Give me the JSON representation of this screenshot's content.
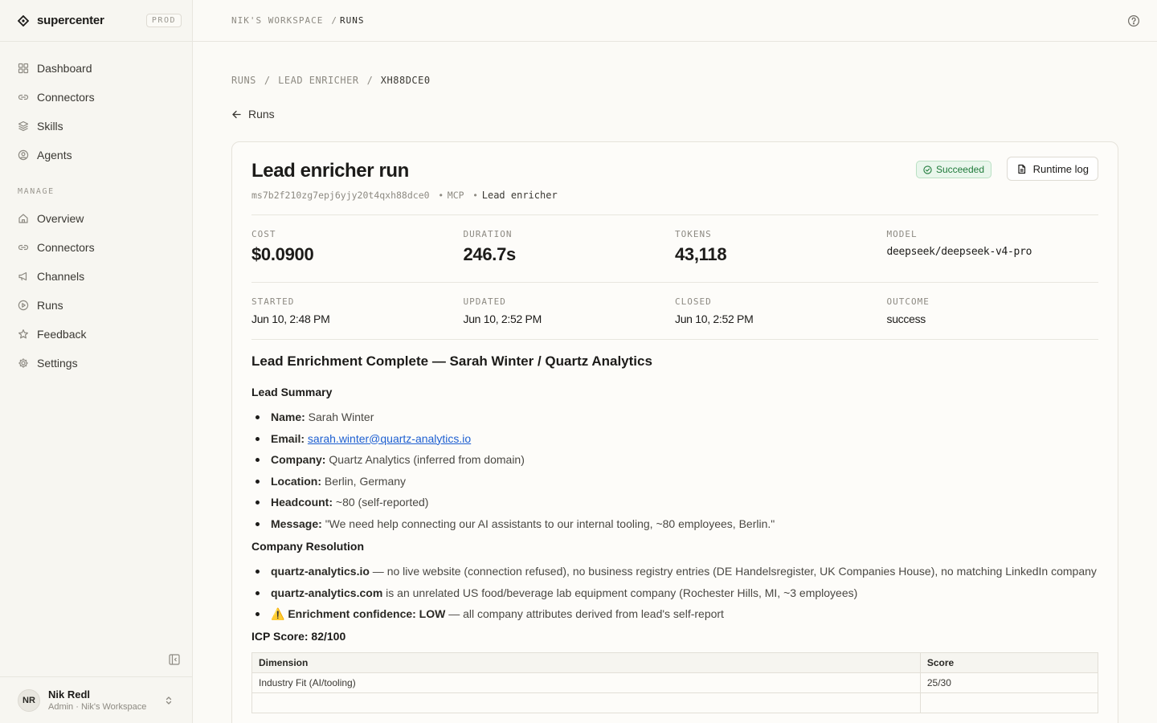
{
  "sidebar": {
    "brand": "supercenter",
    "env": "PROD",
    "items": [
      {
        "label": "Dashboard",
        "icon": "grid-icon"
      },
      {
        "label": "Connectors",
        "icon": "link-icon"
      },
      {
        "label": "Skills",
        "icon": "layers-icon"
      },
      {
        "label": "Agents",
        "icon": "user-circle-icon"
      }
    ],
    "manage_label": "MANAGE",
    "manage_items": [
      {
        "label": "Overview",
        "icon": "home-icon"
      },
      {
        "label": "Connectors",
        "icon": "link-icon"
      },
      {
        "label": "Channels",
        "icon": "megaphone-icon"
      },
      {
        "label": "Runs",
        "icon": "play-circle-icon"
      },
      {
        "label": "Feedback",
        "icon": "star-icon"
      },
      {
        "label": "Settings",
        "icon": "gear-icon"
      }
    ],
    "user": {
      "initials": "NR",
      "name": "Nik Redl",
      "subtitle": "Admin · Nik's Workspace"
    }
  },
  "topbar": {
    "workspace": "NIK'S WORKSPACE",
    "separator": "/",
    "current": "RUNS"
  },
  "page": {
    "breadcrumbs": [
      "RUNS",
      "LEAD ENRICHER",
      "XH88DCE0"
    ],
    "back_label": "Runs"
  },
  "run": {
    "title": "Lead enricher run",
    "id": "ms7b2f210zg7epj6yjy20t4qxh88dce0",
    "channel": "MCP",
    "agent": "Lead enricher",
    "status": "Succeeded",
    "log_button": "Runtime log",
    "stats": {
      "cost_label": "COST",
      "cost": "$0.0900",
      "duration_label": "DURATION",
      "duration": "246.7s",
      "tokens_label": "TOKENS",
      "tokens": "43,118",
      "model_label": "MODEL",
      "model": "deepseek/deepseek-v4-pro",
      "started_label": "STARTED",
      "started": "Jun 10, 2:48 PM",
      "updated_label": "UPDATED",
      "updated": "Jun 10, 2:52 PM",
      "closed_label": "CLOSED",
      "closed": "Jun 10, 2:52 PM",
      "outcome_label": "OUTCOME",
      "outcome": "success"
    }
  },
  "report": {
    "heading": "Lead Enrichment Complete — Sarah Winter / Quartz Analytics",
    "summary_heading": "Lead Summary",
    "summary": [
      {
        "key": "Name:",
        "value": " Sarah Winter"
      },
      {
        "key": "Email:",
        "link": "sarah.winter@quartz-analytics.io"
      },
      {
        "key": "Company:",
        "value": " Quartz Analytics (inferred from domain)"
      },
      {
        "key": "Location:",
        "value": " Berlin, Germany"
      },
      {
        "key": "Headcount:",
        "value": " ~80 (self-reported)"
      },
      {
        "key": "Message:",
        "value": " \"We need help connecting our AI assistants to our internal tooling, ~80 employees, Berlin.\""
      }
    ],
    "resolution_heading": "Company Resolution",
    "resolution": [
      {
        "key": "quartz-analytics.io",
        "value": " — no live website (connection refused), no business registry entries (DE Handelsregister, UK Companies House), no matching LinkedIn company"
      },
      {
        "key": "quartz-analytics.com",
        "value": " is an unrelated US food/beverage lab equipment company (Rochester Hills, MI, ~3 employees)"
      },
      {
        "prefix": "⚠️ ",
        "key": "Enrichment confidence: LOW",
        "value": " — all company attributes derived from lead's self-report"
      }
    ],
    "icp_heading": "ICP Score: 82/100",
    "icp_columns": [
      "Dimension",
      "Score"
    ],
    "icp_rows": [
      [
        "Industry Fit (AI/tooling)",
        "25/30"
      ],
      [
        "",
        ""
      ]
    ]
  }
}
